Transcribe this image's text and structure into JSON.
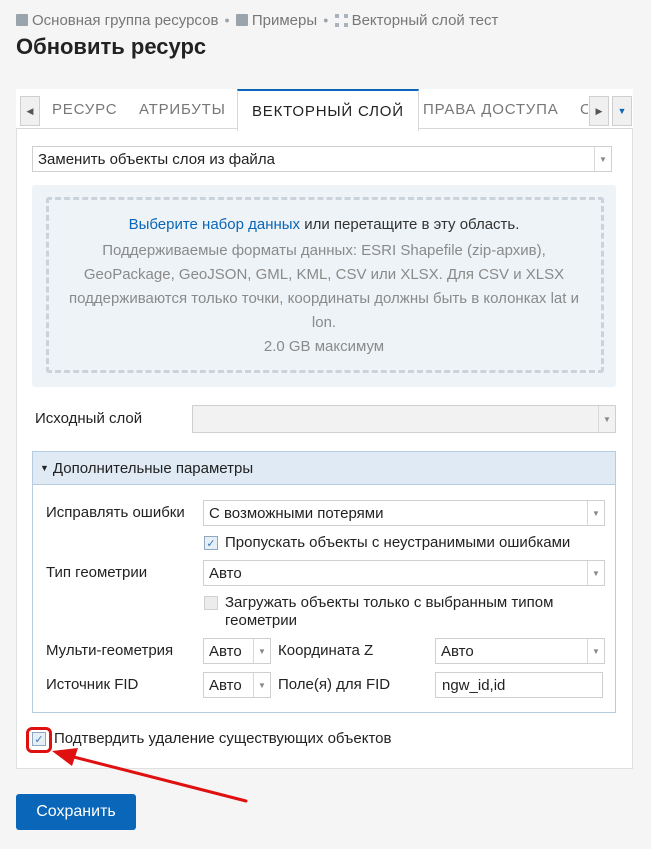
{
  "breadcrumb": {
    "items": [
      "Основная группа ресурсов",
      "Примеры",
      "Векторный слой тест"
    ]
  },
  "page_title": "Обновить ресурс",
  "tabs": [
    {
      "label": "Ресурс"
    },
    {
      "label": "Атрибуты"
    },
    {
      "label": "Векторный слой"
    },
    {
      "label": "Права доступа"
    },
    {
      "label": "С"
    }
  ],
  "active_tab": "Векторный слой",
  "action_select": {
    "value": "Заменить объекты слоя из файла"
  },
  "upload": {
    "link_text": "Выберите набор данных",
    "main_rest": " или перетащите в эту область.",
    "formats_lines": [
      "Поддерживаемые форматы данных: ESRI Shapefile (zip-архив),",
      "GeoPackage, GeoJSON, GML, KML, CSV или XLSX. Для CSV и XLSX",
      "поддерживаются только точки, координаты должны быть в колонках lat и",
      "lon."
    ],
    "max_size": "2.0 GB максимум"
  },
  "source_layer": {
    "label": "Исходный слой",
    "value": ""
  },
  "advanced": {
    "title": "Дополнительные параметры",
    "fix_errors": {
      "label": "Исправлять ошибки",
      "value": "С возможными потерями"
    },
    "skip_errors": {
      "label": "Пропускать объекты с неустранимыми ошибками",
      "checked": true
    },
    "geometry_type": {
      "label": "Тип геометрии",
      "value": "Авто"
    },
    "only_selected_type": {
      "label_line1": "Загружать объекты только с выбранным типом",
      "label_line2": "геометрии",
      "checked": false,
      "disabled": true
    },
    "multi_geometry": {
      "label": "Мульти-геометрия",
      "value": "Авто"
    },
    "z_coordinate": {
      "label": "Координата Z",
      "value": "Авто"
    },
    "fid_source": {
      "label": "Источник FID",
      "value": "Авто"
    },
    "fid_fields": {
      "label": "Поле(я) для FID",
      "value": "ngw_id,id"
    }
  },
  "confirm_delete": {
    "label": "Подтвердить удаление существующих объектов",
    "checked": true
  },
  "save_button": "Сохранить",
  "colors": {
    "accent": "#0a66b8",
    "highlight": "#e01010"
  }
}
